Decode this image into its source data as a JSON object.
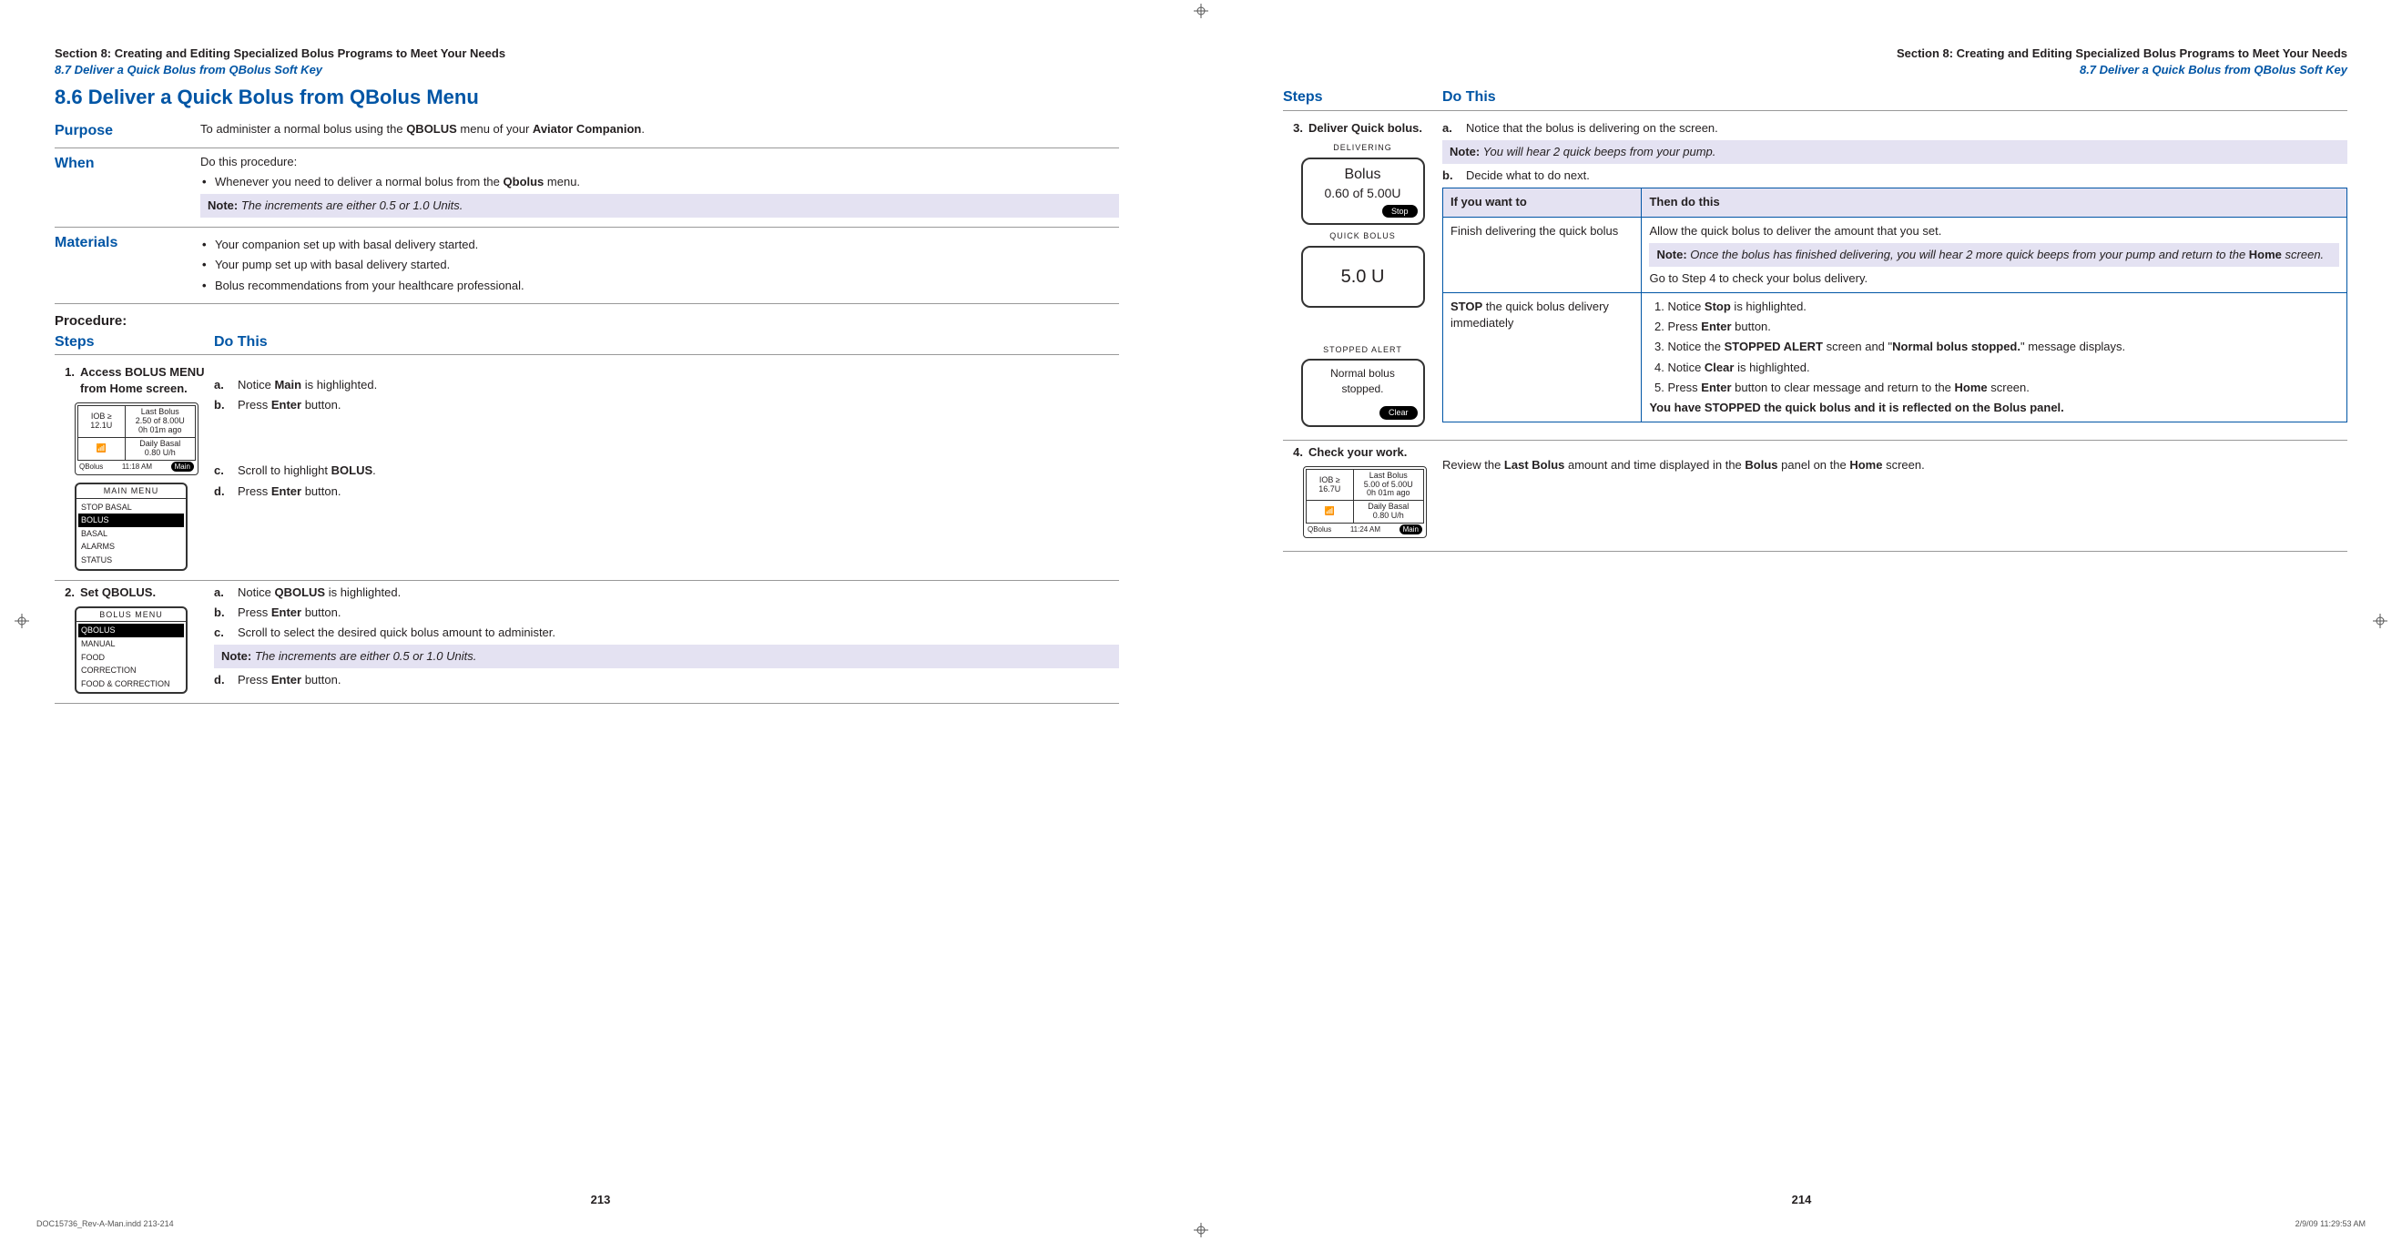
{
  "left": {
    "running_head": "Section 8: Creating and Editing Specialized Bolus Programs to Meet Your Needs",
    "running_sub": "8.7 Deliver a Quick Bolus from QBolus Soft Key",
    "heading": "8.6   Deliver a Quick Bolus from QBolus Menu",
    "purpose_label": "Purpose",
    "purpose_text_pre": "To administer a normal bolus using the ",
    "purpose_bold1": "QBOLUS",
    "purpose_text_mid": " menu of your ",
    "purpose_bold2": "Aviator Companion",
    "purpose_text_end": ".",
    "when_label": "When",
    "when_intro": "Do this procedure:",
    "when_bullet_pre": "Whenever you need to deliver a normal bolus from the ",
    "when_bullet_bold": "Qbolus",
    "when_bullet_end": " menu.",
    "when_note_label": "Note:",
    "when_note_text": " The increments are either 0.5 or 1.0 Units.",
    "materials_label": "Materials",
    "materials": [
      "Your companion set up with basal delivery started.",
      "Your pump set up with basal delivery started.",
      "Bolus recommendations from your healthcare professional."
    ],
    "procedure_label": "Procedure:",
    "steps_head": "Steps",
    "dothis_head": "Do This",
    "step1_num": "1.",
    "step1_title_pre": "Access ",
    "step1_title_bold": "BOLUS MENU",
    "step1_title_end": " from Home screen.",
    "step1a": {
      "n": "a.",
      "pre": "Notice ",
      "b": "Main",
      "end": " is highlighted."
    },
    "step1b": {
      "n": "b.",
      "pre": "Press ",
      "b": "Enter",
      "end": " button."
    },
    "step1c": {
      "n": "c.",
      "pre": "Scroll to highlight ",
      "b": "BOLUS",
      "end": "."
    },
    "step1d": {
      "n": "d.",
      "pre": "Press ",
      "b": "Enter",
      "end": " button."
    },
    "home_screen": {
      "iob_label": "IOB ≥",
      "iob_val": "12.1U",
      "last_label": "Last Bolus",
      "last_val": "2.50 of 8.00U",
      "last_time": "0h 01m ago",
      "basal_label": "Daily Basal",
      "basal_val": "0.80 U/h",
      "footer_l": "QBolus",
      "footer_time": "11:18 AM",
      "footer_r": "Main"
    },
    "main_menu": {
      "title": "MAIN MENU",
      "items": [
        "STOP BASAL",
        "BOLUS",
        "BASAL",
        "ALARMS",
        "STATUS"
      ],
      "selected": "BOLUS"
    },
    "step2_num": "2.",
    "step2_title_pre": "Set ",
    "step2_title_bold": "QBOLUS.",
    "step2a": {
      "n": "a.",
      "pre": "Notice ",
      "b": "QBOLUS",
      "end": " is highlighted."
    },
    "step2b": {
      "n": "b.",
      "pre": "Press ",
      "b": "Enter",
      "end": " button."
    },
    "step2c": {
      "n": "c.",
      "text": "Scroll to select the desired quick bolus amount to administer."
    },
    "step2_note_label": "Note:",
    "step2_note_text": " The increments are either 0.5 or 1.0 Units.",
    "step2d": {
      "n": "d.",
      "pre": "Press ",
      "b": "Enter",
      "end": " button."
    },
    "bolus_menu": {
      "title": "BOLUS MENU",
      "items": [
        "QBOLUS",
        "MANUAL",
        "FOOD",
        "CORRECTION",
        "FOOD & CORRECTION"
      ],
      "selected": "QBOLUS"
    },
    "page_num": "213"
  },
  "right": {
    "running_head": "Section 8: Creating and Editing Specialized Bolus Programs to Meet Your Needs",
    "running_sub": "8.7 Deliver a Quick Bolus from QBolus Soft Key",
    "steps_head": "Steps",
    "dothis_head": "Do This",
    "step3_num": "3.",
    "step3_title": "Deliver Quick bolus.",
    "step3a": {
      "n": "a.",
      "text": "Notice that the bolus is delivering on the screen."
    },
    "step3_note_label": "Note:",
    "step3_note_text": " You will hear 2 quick beeps from your pump.",
    "step3b": {
      "n": "b.",
      "text": "Decide what to do next."
    },
    "delivering": {
      "title": "DELIVERING",
      "line1": "Bolus",
      "line2": "0.60 of 5.00U",
      "btn": "Stop"
    },
    "quickbolus": {
      "title": "QUICK BOLUS",
      "val": "5.0 U"
    },
    "stopped": {
      "title": "STOPPED ALERT",
      "line1": "Normal bolus",
      "line2": "stopped.",
      "btn": "Clear"
    },
    "dec_th1": "If you want to",
    "dec_th2": "Then do this",
    "dec_r1_c1": "Finish delivering the quick bolus",
    "dec_r1_c2_a": "Allow the quick bolus to deliver the amount that you set.",
    "dec_r1_note_label": "Note:",
    "dec_r1_note_pre": " Once the bolus has finished delivering, you will hear 2 more quick beeps from your pump and return to the ",
    "dec_r1_note_bold": "Home",
    "dec_r1_note_end": " screen.",
    "dec_r1_c2_b": "Go to Step 4 to check your bolus delivery.",
    "dec_r2_c1_b1": "STOP",
    "dec_r2_c1_rest": " the quick bolus delivery immediately",
    "dec_r2_li1": {
      "pre": "Notice ",
      "b": "Stop",
      "end": " is highlighted."
    },
    "dec_r2_li2": {
      "pre": "Press ",
      "b": "Enter",
      "end": " button."
    },
    "dec_r2_li3": {
      "pre": "Notice the ",
      "b1": "STOPPED ALERT",
      "mid": " screen and \"",
      "b2": "Normal bolus stopped.",
      "end": "\" message displays."
    },
    "dec_r2_li4": {
      "pre": "Notice ",
      "b": "Clear",
      "end": " is highlighted."
    },
    "dec_r2_li5": {
      "pre": "Press ",
      "b1": "Enter",
      "mid": " button to clear message and return to the ",
      "b2": "Home",
      "end": " screen."
    },
    "dec_r2_final": "You have STOPPED the quick bolus and it is reflected on the Bolus panel.",
    "step4_num": "4.",
    "step4_title": "Check your work.",
    "step4_text_pre": "Review the ",
    "step4_b1": "Last Bolus",
    "step4_mid": " amount and time displayed in the ",
    "step4_b2": "Bolus",
    "step4_mid2": " panel on the ",
    "step4_b3": "Home",
    "step4_end": " screen.",
    "home_screen2": {
      "iob_label": "IOB ≥",
      "iob_val": "16.7U",
      "last_label": "Last Bolus",
      "last_val": "5.00 of 5.00U",
      "last_time": "0h 01m ago",
      "basal_label": "Daily Basal",
      "basal_val": "0.80 U/h",
      "footer_l": "QBolus",
      "footer_time": "11:24 AM",
      "footer_r": "Main"
    },
    "page_num": "214"
  },
  "footer": {
    "left": "DOC15736_Rev-A-Man.indd   213-214",
    "right": "2/9/09   11:29:53 AM"
  }
}
